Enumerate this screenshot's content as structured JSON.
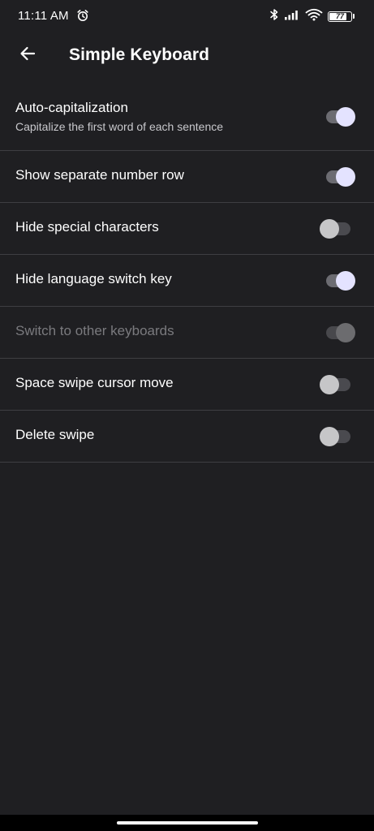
{
  "status_bar": {
    "time": "11:11 AM",
    "battery_level": "77",
    "icons": [
      "alarm-icon",
      "bluetooth-icon",
      "signal-icon",
      "wifi-icon",
      "battery-icon"
    ]
  },
  "app_bar": {
    "back_icon": "arrow-left-icon",
    "title": "Simple Keyboard"
  },
  "settings": [
    {
      "title": "Auto-capitalization",
      "subtitle": "Capitalize the first word of each sentence",
      "enabled": true,
      "checked": true
    },
    {
      "title": "Show separate number row",
      "enabled": true,
      "checked": true
    },
    {
      "title": "Hide special characters",
      "enabled": true,
      "checked": false
    },
    {
      "title": "Hide language switch key",
      "enabled": true,
      "checked": true
    },
    {
      "title": "Switch to other keyboards",
      "enabled": false,
      "checked": true
    },
    {
      "title": "Space swipe cursor move",
      "enabled": true,
      "checked": false
    },
    {
      "title": "Delete swipe",
      "enabled": true,
      "checked": false
    }
  ],
  "colors": {
    "background": "#1f1f22",
    "divider": "#3e3e42",
    "switch_on_thumb": "#e4e3ff",
    "switch_off_thumb": "#c6c6c8",
    "disabled_text": "#7a7a7e"
  }
}
